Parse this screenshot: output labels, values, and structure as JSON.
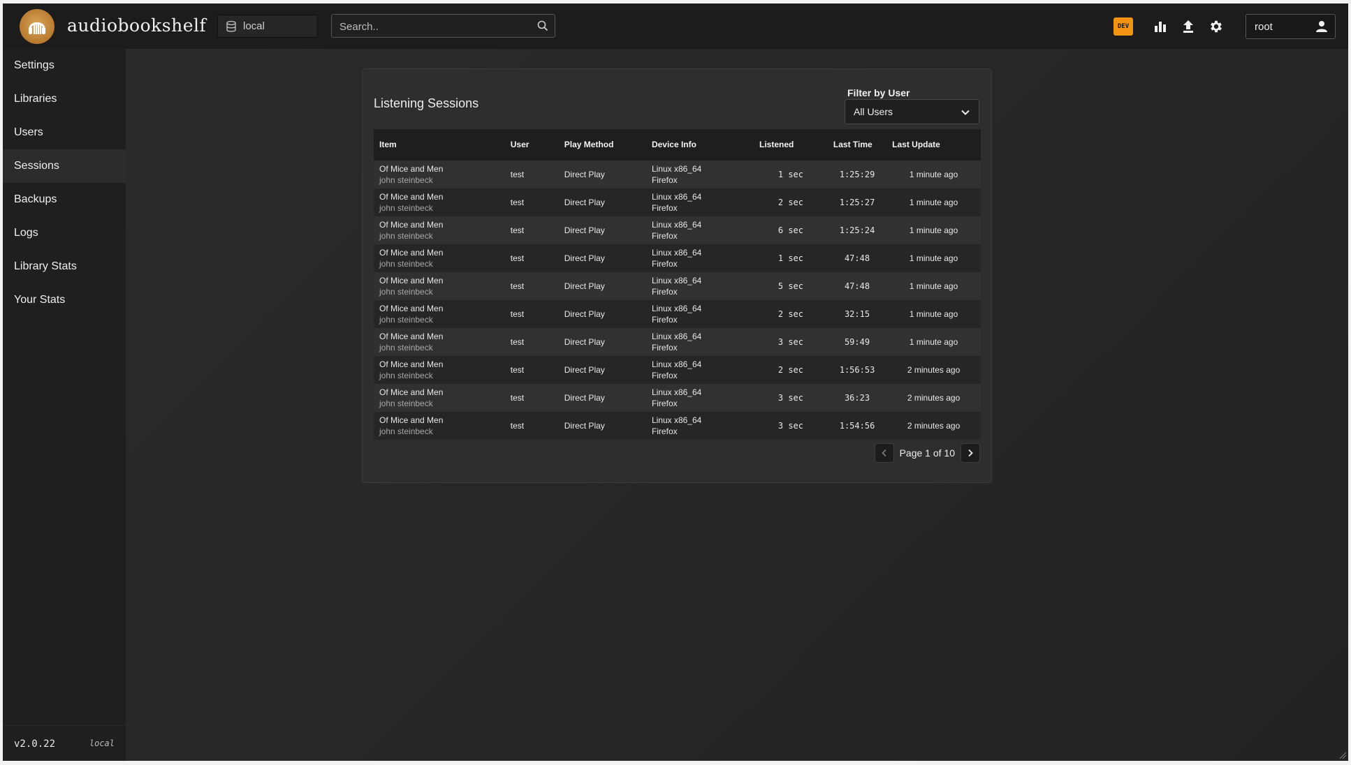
{
  "header": {
    "app_title": "audiobookshelf",
    "library": "local",
    "search_placeholder": "Search..",
    "dev_badge": "DEV",
    "username": "root"
  },
  "sidebar": {
    "items": [
      {
        "label": "Settings"
      },
      {
        "label": "Libraries"
      },
      {
        "label": "Users"
      },
      {
        "label": "Sessions",
        "active": true
      },
      {
        "label": "Backups"
      },
      {
        "label": "Logs"
      },
      {
        "label": "Library Stats"
      },
      {
        "label": "Your Stats"
      }
    ],
    "version": "v2.0.22",
    "env": "local"
  },
  "sessions_panel": {
    "title": "Listening Sessions",
    "filter_label": "Filter by User",
    "filter_value": "All Users",
    "columns": [
      "Item",
      "User",
      "Play Method",
      "Device Info",
      "Listened",
      "Last Time",
      "Last Update"
    ],
    "rows": [
      {
        "title": "Of Mice and Men",
        "author": "john steinbeck",
        "user": "test",
        "method": "Direct Play",
        "os": "Linux x86_64",
        "browser": "Firefox",
        "listened": "1 sec",
        "last_time": "1:25:29",
        "updated": "1 minute ago"
      },
      {
        "title": "Of Mice and Men",
        "author": "john steinbeck",
        "user": "test",
        "method": "Direct Play",
        "os": "Linux x86_64",
        "browser": "Firefox",
        "listened": "2 sec",
        "last_time": "1:25:27",
        "updated": "1 minute ago"
      },
      {
        "title": "Of Mice and Men",
        "author": "john steinbeck",
        "user": "test",
        "method": "Direct Play",
        "os": "Linux x86_64",
        "browser": "Firefox",
        "listened": "6 sec",
        "last_time": "1:25:24",
        "updated": "1 minute ago"
      },
      {
        "title": "Of Mice and Men",
        "author": "john steinbeck",
        "user": "test",
        "method": "Direct Play",
        "os": "Linux x86_64",
        "browser": "Firefox",
        "listened": "1 sec",
        "last_time": "47:48",
        "updated": "1 minute ago"
      },
      {
        "title": "Of Mice and Men",
        "author": "john steinbeck",
        "user": "test",
        "method": "Direct Play",
        "os": "Linux x86_64",
        "browser": "Firefox",
        "listened": "5 sec",
        "last_time": "47:48",
        "updated": "1 minute ago"
      },
      {
        "title": "Of Mice and Men",
        "author": "john steinbeck",
        "user": "test",
        "method": "Direct Play",
        "os": "Linux x86_64",
        "browser": "Firefox",
        "listened": "2 sec",
        "last_time": "32:15",
        "updated": "1 minute ago"
      },
      {
        "title": "Of Mice and Men",
        "author": "john steinbeck",
        "user": "test",
        "method": "Direct Play",
        "os": "Linux x86_64",
        "browser": "Firefox",
        "listened": "3 sec",
        "last_time": "59:49",
        "updated": "1 minute ago"
      },
      {
        "title": "Of Mice and Men",
        "author": "john steinbeck",
        "user": "test",
        "method": "Direct Play",
        "os": "Linux x86_64",
        "browser": "Firefox",
        "listened": "2 sec",
        "last_time": "1:56:53",
        "updated": "2 minutes ago"
      },
      {
        "title": "Of Mice and Men",
        "author": "john steinbeck",
        "user": "test",
        "method": "Direct Play",
        "os": "Linux x86_64",
        "browser": "Firefox",
        "listened": "3 sec",
        "last_time": "36:23",
        "updated": "2 minutes ago"
      },
      {
        "title": "Of Mice and Men",
        "author": "john steinbeck",
        "user": "test",
        "method": "Direct Play",
        "os": "Linux x86_64",
        "browser": "Firefox",
        "listened": "3 sec",
        "last_time": "1:54:56",
        "updated": "2 minutes ago"
      }
    ],
    "pagination": "Page 1 of 10"
  },
  "icons": {
    "library": "database-icon",
    "search": "search-icon",
    "stats": "bar-chart-icon",
    "upload": "upload-icon",
    "settings": "gear-icon",
    "user": "person-icon"
  },
  "colors": {
    "dev_badge": "#f29312",
    "logo": "#c08a3e"
  }
}
